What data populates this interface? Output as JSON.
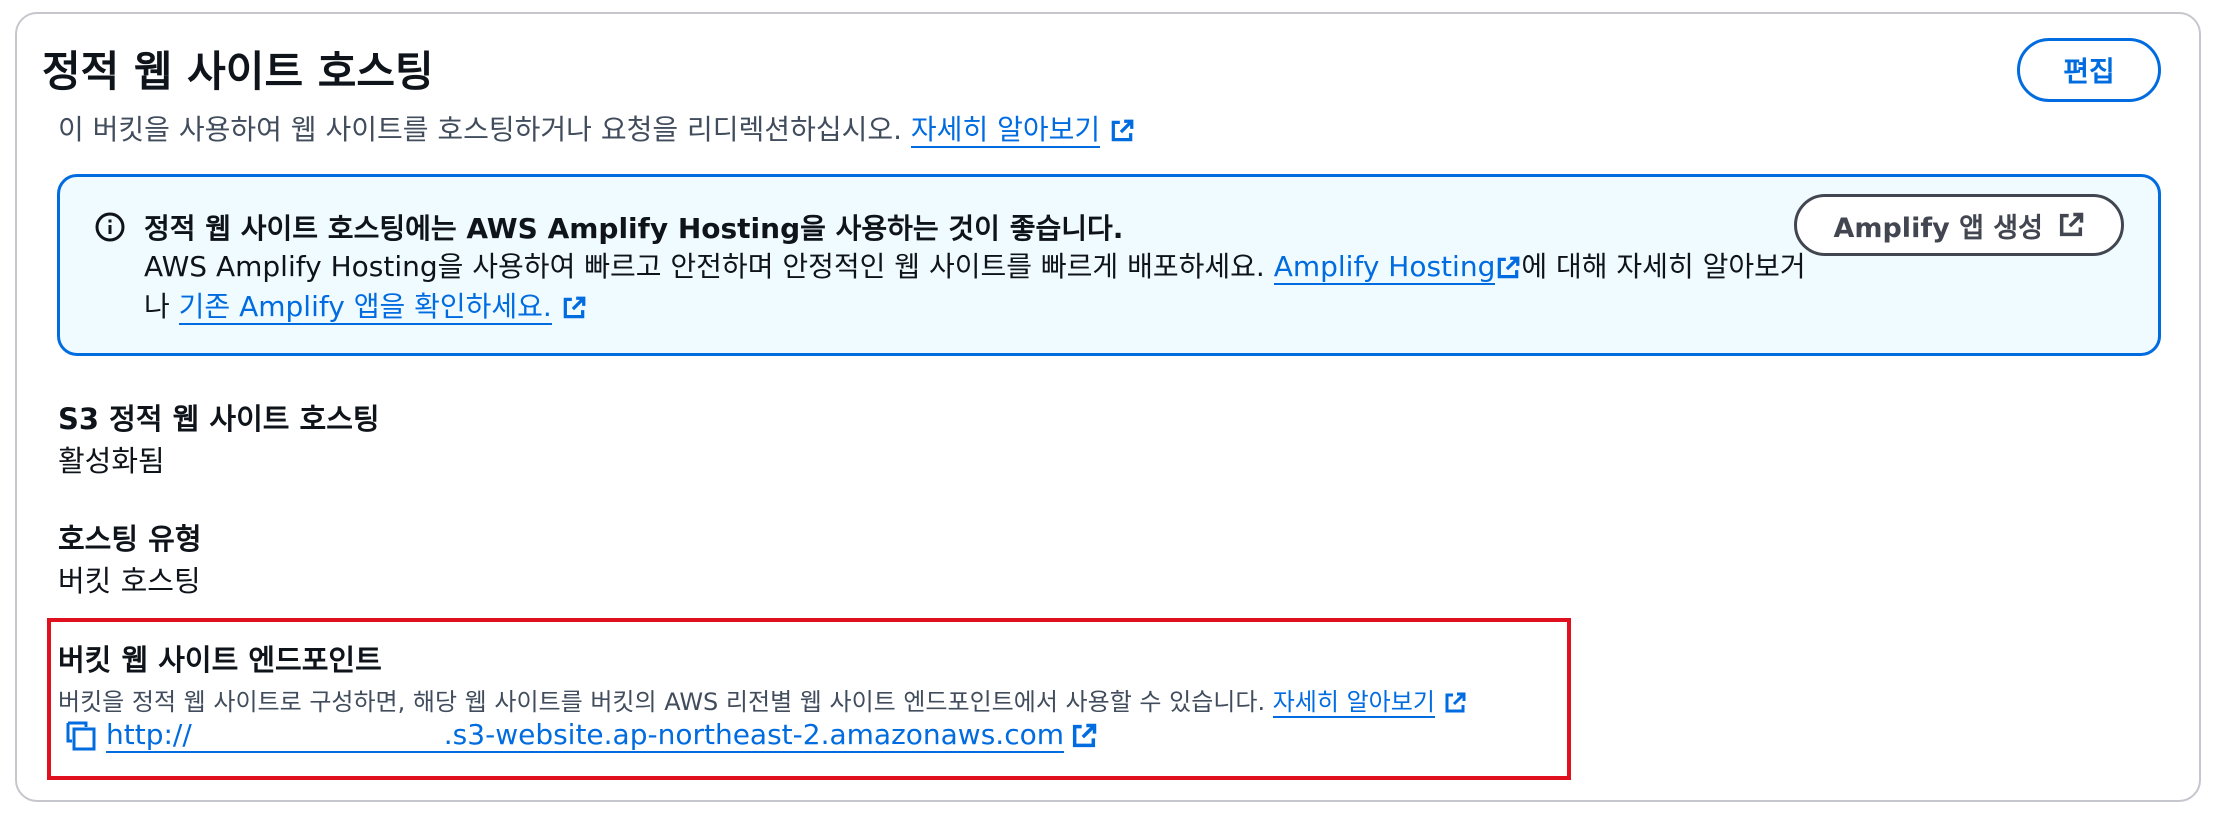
{
  "header": {
    "title": "정적 웹 사이트 호스팅",
    "subtitle": "이 버킷을 사용하여 웹 사이트를 호스팅하거나 요청을 리디렉션하십시오.",
    "learn_more": "자세히 알아보기",
    "edit_label": "편집"
  },
  "info": {
    "title": "정적 웹 사이트 호스팅에는 AWS Amplify Hosting을 사용하는 것이 좋습니다.",
    "body_part1": "AWS Amplify Hosting을 사용하여 빠르고 안전하며 안정적인 웹 사이트를 빠르게 배포하세요. ",
    "link1": "Amplify Hosting",
    "body_part2": "에 대해 자세히 알아보거나 ",
    "link2": "기존 Amplify 앱을 확인하세요.",
    "create_button": "Amplify 앱 생성"
  },
  "fields": {
    "s3_hosting_label": "S3 정적 웹 사이트 호스팅",
    "s3_hosting_value": "활성화됨",
    "hosting_type_label": "호스팅 유형",
    "hosting_type_value": "버킷 호스팅",
    "endpoint_label": "버킷 웹 사이트 엔드포인트",
    "endpoint_desc": "버킷을 정적 웹 사이트로 구성하면, 해당 웹 사이트를 버킷의 AWS 리전별 웹 사이트 엔드포인트에서 사용할 수 있습니다.",
    "endpoint_learn_more": "자세히 알아보기",
    "endpoint_url_prefix": "http://",
    "endpoint_url_suffix": ".s3-website.ap-northeast-2.amazonaws.com"
  },
  "icons": {
    "info": "info-circle-icon",
    "external": "external-link-icon",
    "copy": "copy-icon"
  },
  "colors": {
    "link": "#006ce0",
    "info_bg": "#f0fbff",
    "highlight_border": "#e0101f"
  }
}
